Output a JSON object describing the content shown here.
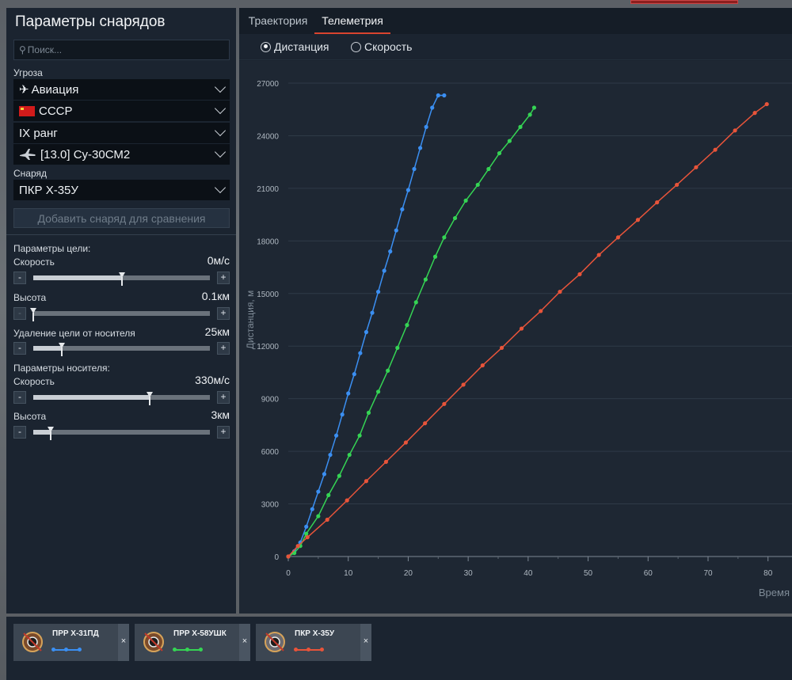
{
  "panel_title": "Параметры снарядов",
  "search": {
    "placeholder": "Поиск..."
  },
  "threat": {
    "label": "Угроза",
    "category": "Авиация",
    "country": "СССР",
    "rank": "IX ранг",
    "vehicle": "[13.0] Су-30СМ2"
  },
  "shell": {
    "label": "Снаряд",
    "value": "ПКР Х-35У",
    "add_compare": "Добавить снаряд для сравнения"
  },
  "target_params": {
    "header": "Параметры цели:",
    "speed": {
      "label": "Скорость",
      "value": "0м/с",
      "fraction": 0.5
    },
    "altitude": {
      "label": "Высота",
      "value": "0.1км",
      "fraction": 0.0
    },
    "distance": {
      "label": "Удаление цели от носителя",
      "value": "25км",
      "fraction": 0.16
    }
  },
  "carrier_params": {
    "header": "Параметры носителя:",
    "speed": {
      "label": "Скорость",
      "value": "330м/с",
      "fraction": 0.66
    },
    "altitude": {
      "label": "Высота",
      "value": "3км",
      "fraction": 0.1
    }
  },
  "slider_labels": {
    "minus": "-",
    "plus": "+"
  },
  "tabs": [
    {
      "label": "Траектория",
      "active": false
    },
    {
      "label": "Телеметрия",
      "active": true
    }
  ],
  "modes": [
    {
      "label": "Дистанция",
      "selected": true
    },
    {
      "label": "Скорость",
      "selected": false
    }
  ],
  "compare_cards": [
    {
      "name": "ПРР Х-31ПД",
      "color": "#3b8ff2"
    },
    {
      "name": "ПРР Х-58УШК",
      "color": "#35d454"
    },
    {
      "name": "ПКР Х-35У",
      "color": "#e8543a"
    }
  ],
  "close_glyph": "×",
  "chart_data": {
    "type": "line",
    "xlabel": "Время",
    "ylabel": "Дистанция, м",
    "xlim": [
      0,
      84
    ],
    "ylim": [
      0,
      27000
    ],
    "xticks": [
      0,
      10,
      20,
      30,
      40,
      50,
      60,
      70,
      80
    ],
    "yticks": [
      0,
      3000,
      6000,
      9000,
      12000,
      15000,
      18000,
      21000,
      24000,
      27000
    ],
    "grid": "horizontal",
    "series": [
      {
        "name": "ПРР Х-31ПД",
        "color": "#3b8ff2",
        "x": [
          0,
          1,
          2,
          3,
          4,
          5,
          6,
          7,
          8,
          9,
          10,
          11,
          12,
          13,
          14,
          15,
          16,
          17,
          18,
          19,
          20,
          21,
          22,
          23,
          24,
          25,
          26
        ],
        "y": [
          0,
          300,
          800,
          1700,
          2700,
          3700,
          4700,
          5800,
          6900,
          8100,
          9300,
          10400,
          11600,
          12800,
          13900,
          15100,
          16300,
          17400,
          18600,
          19800,
          20900,
          22100,
          23300,
          24500,
          25600,
          26300,
          26300
        ]
      },
      {
        "name": "ПРР Х-58УШК",
        "color": "#35d454",
        "x": [
          0,
          1,
          2,
          3,
          5,
          6.7,
          8.5,
          10.2,
          11.9,
          13.4,
          15,
          16.6,
          18.2,
          19.8,
          21.3,
          22.9,
          24.5,
          26,
          27.8,
          29.6,
          31.6,
          33.4,
          35.2,
          36.9,
          38.7,
          40.3,
          41
        ],
        "y": [
          0,
          200,
          600,
          1300,
          2300,
          3500,
          4600,
          5800,
          6900,
          8200,
          9400,
          10600,
          11900,
          13200,
          14500,
          15800,
          17100,
          18200,
          19300,
          20300,
          21200,
          22100,
          23000,
          23700,
          24500,
          25200,
          25600
        ]
      },
      {
        "name": "ПКР Х-35У",
        "color": "#e8543a",
        "x": [
          0,
          1.6,
          3.2,
          6.5,
          9.8,
          13,
          16.3,
          19.6,
          22.8,
          26,
          29.2,
          32.4,
          35.6,
          38.9,
          42.1,
          45.3,
          48.6,
          51.8,
          55,
          58.3,
          61.5,
          64.8,
          68,
          71.2,
          74.5,
          77.8,
          79.8
        ],
        "y": [
          0,
          600,
          1100,
          2100,
          3200,
          4300,
          5400,
          6500,
          7600,
          8700,
          9800,
          10900,
          11900,
          13000,
          14000,
          15100,
          16100,
          17200,
          18200,
          19200,
          20200,
          21200,
          22200,
          23200,
          24300,
          25300,
          25800
        ]
      }
    ]
  }
}
